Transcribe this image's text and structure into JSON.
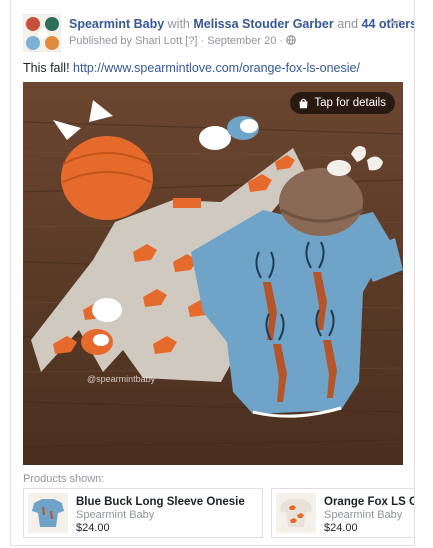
{
  "post": {
    "page_name": "Spearmint Baby",
    "with_word": "with",
    "tagged_name": "Melissa Stouder Garber",
    "and_word": "and",
    "others": "44 others.",
    "published_prefix": "Published by",
    "publisher": "Shari Lott",
    "help_marker": "[?]",
    "separator": "·",
    "date": "September 20",
    "separator2": "·",
    "body_text": "This fall!",
    "link": "http://www.spearmintlove.com/orange-fox-ls-onesie/"
  },
  "photo": {
    "tap_label": "Tap for details",
    "watermark": "@spearmintbaby"
  },
  "products": {
    "label": "Products shown:",
    "items": [
      {
        "name": "Blue Buck Long Sleeve Onesie",
        "brand": "Spearmint Baby",
        "price": "$24.00"
      },
      {
        "name": "Orange Fox LS One",
        "brand": "Spearmint Baby",
        "price": "$24.00"
      }
    ]
  },
  "colors": {
    "link": "#365899",
    "meta": "#90949c",
    "fox_orange": "#e56a2b",
    "onesie_blue": "#6fa3c7",
    "wood": "#5b3a26"
  }
}
